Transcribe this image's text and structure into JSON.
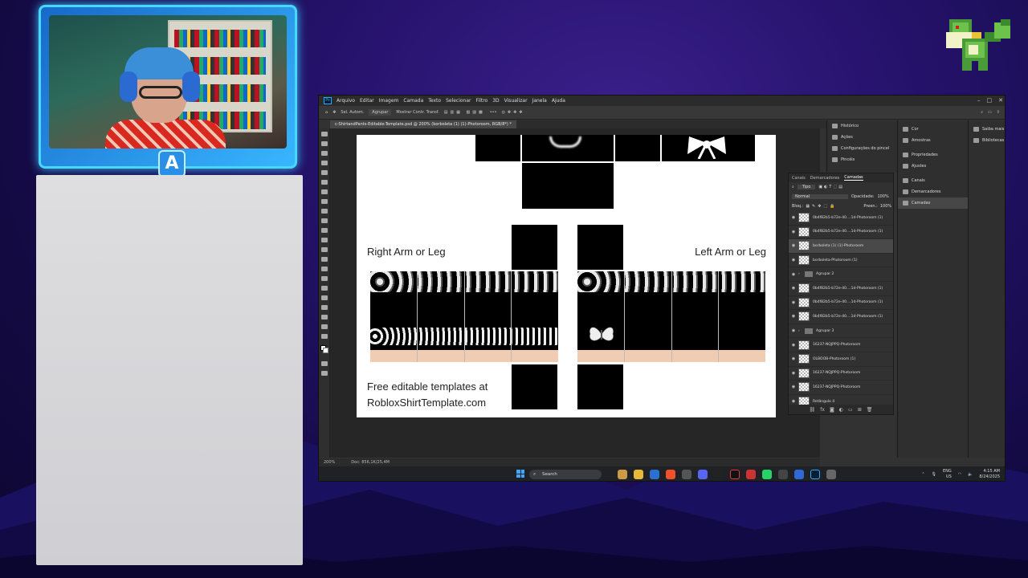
{
  "overlay": {
    "badge_letter": "A"
  },
  "photoshop": {
    "logo": "Ps",
    "menu": [
      "Arquivo",
      "Editar",
      "Imagem",
      "Camada",
      "Texto",
      "Selecionar",
      "Filtro",
      "3D",
      "Visualizar",
      "Janela",
      "Ajuda"
    ],
    "options": [
      "Sel. Autom.",
      "Agrupar",
      "Mostrar Contr. Transf."
    ],
    "doc_tab": "c-ShirtandPants-Editable-Template.psd @ 200% (borboleta (1) (1)-Photoroom, RGB/8*) *",
    "status_zoom": "200%",
    "status_doc": "Doc: 856,1K/25,4M",
    "right_col_a": [
      "Histórico",
      "Ações",
      "Configurações do pincel",
      "Pincéis"
    ],
    "right_col_b": [
      "Cor",
      "Amostras",
      "Propriedades",
      "Ajustes",
      "Canais",
      "Demarcadores",
      "Camadas"
    ],
    "right_col_c": [
      "Saiba mais",
      "Bibliotecas"
    ],
    "layers_panel": {
      "tabs": [
        "Canais",
        "Demarcadores",
        "Camadas"
      ],
      "kind_filter": "Tipo",
      "blend_mode": "Normal",
      "opacity_label": "Opacidade:",
      "opacity_value": "100%",
      "lock_label": "Bloq.:",
      "fill_label": "Preen.:",
      "fill_value": "100%",
      "rows": [
        {
          "name": "0b4f82b5-b72e-40....1d-Photoroom (1)",
          "type": "layer",
          "selected": false
        },
        {
          "name": "0b4f82b5-b72e-40....1d-Photoroom (1)",
          "type": "layer",
          "selected": false
        },
        {
          "name": "borboleta (1) (1)-Photoroom",
          "type": "layer",
          "selected": true
        },
        {
          "name": "borboleta-Photoroom (1)",
          "type": "layer",
          "selected": false
        },
        {
          "name": "Agrupar 2",
          "type": "group",
          "selected": false
        },
        {
          "name": "0b4f82b5-b72e-40....1d-Photoroom (1)",
          "type": "layer",
          "selected": false
        },
        {
          "name": "0b4f82b5-b72e-40....1d-Photoroom (1)",
          "type": "layer",
          "selected": false
        },
        {
          "name": "0b4f82b5-b72e-40....1d-Photoroom (1)",
          "type": "layer",
          "selected": false
        },
        {
          "name": "Agrupar 3",
          "type": "group",
          "selected": false
        },
        {
          "name": "16237-NQJPPQ-Photoroom",
          "type": "layer",
          "selected": false
        },
        {
          "name": "OLBOOB-Photoroom (1)",
          "type": "layer",
          "selected": false
        },
        {
          "name": "16237-NQJPPQ-Photoroom",
          "type": "layer",
          "selected": false
        },
        {
          "name": "16237-NQJPPQ-Photoroom",
          "type": "layer",
          "selected": false
        },
        {
          "name": "Retângulo 4",
          "type": "layer",
          "selected": false
        }
      ]
    }
  },
  "template": {
    "right_label": "Right Arm or Leg",
    "left_label": "Left Arm or Leg",
    "footer_line1": "Free editable templates at",
    "footer_line2": "RobloxShirtTemplate.com"
  },
  "taskbar": {
    "search_placeholder": "Search",
    "lang_top": "ENG",
    "lang_bottom": "US",
    "time": "4:15 AM",
    "date": "8/24/2025"
  }
}
